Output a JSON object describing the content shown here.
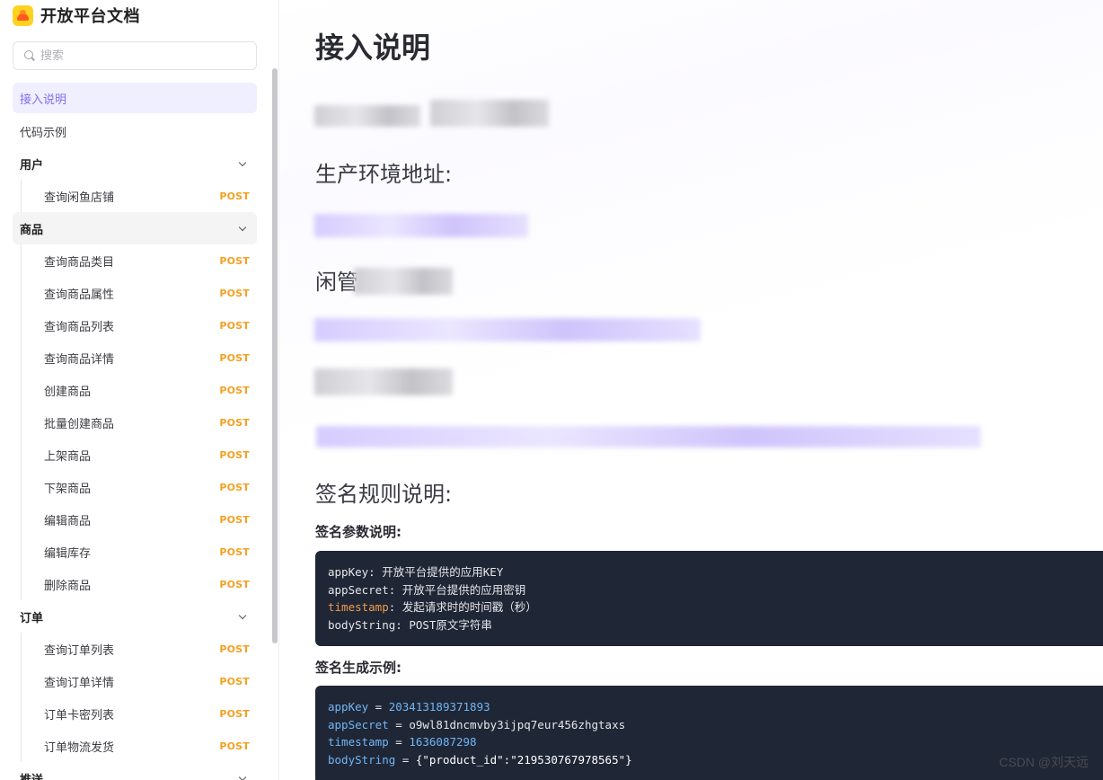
{
  "brand": {
    "title": "开放平台文档",
    "logo_icon": "fish-logo-icon"
  },
  "search": {
    "placeholder": "搜索"
  },
  "sidebar": {
    "intro": "接入说明",
    "code_example": "代码示例",
    "groups": [
      {
        "label": "用户",
        "items": [
          {
            "label": "查询闲鱼店铺",
            "method": "POST"
          }
        ]
      },
      {
        "label": "商品",
        "items": [
          {
            "label": "查询商品类目",
            "method": "POST"
          },
          {
            "label": "查询商品属性",
            "method": "POST"
          },
          {
            "label": "查询商品列表",
            "method": "POST"
          },
          {
            "label": "查询商品详情",
            "method": "POST"
          },
          {
            "label": "创建商品",
            "method": "POST"
          },
          {
            "label": "批量创建商品",
            "method": "POST"
          },
          {
            "label": "上架商品",
            "method": "POST"
          },
          {
            "label": "下架商品",
            "method": "POST"
          },
          {
            "label": "编辑商品",
            "method": "POST"
          },
          {
            "label": "编辑库存",
            "method": "POST"
          },
          {
            "label": "删除商品",
            "method": "POST"
          }
        ]
      },
      {
        "label": "订单",
        "items": [
          {
            "label": "查询订单列表",
            "method": "POST"
          },
          {
            "label": "查询订单详情",
            "method": "POST"
          },
          {
            "label": "订单卡密列表",
            "method": "POST"
          },
          {
            "label": "订单物流发货",
            "method": "POST"
          }
        ]
      },
      {
        "label": "推送",
        "items": []
      }
    ]
  },
  "main": {
    "title": "接入说明",
    "prod_env_heading": "生产环境地址:",
    "xianyu_heading": "闲管",
    "sign_heading": "签名规则说明:",
    "sign_params_heading": "签名参数说明:",
    "sign_example_heading": "签名生成示例:",
    "params_code": [
      {
        "key": "appKey",
        "desc": ": 开放平台提供的应用KEY"
      },
      {
        "key": "appSecret",
        "desc": ": 开放平台提供的应用密钥"
      },
      {
        "key": "timestamp",
        "desc": ": 发起请求时的时间戳（秒）"
      },
      {
        "key": "bodyString",
        "desc": ": POST原文字符串"
      }
    ],
    "example_code": [
      {
        "key": "appKey",
        "op": " = ",
        "value": "203413189371893"
      },
      {
        "key": "appSecret",
        "op": " = ",
        "value": "o9wl81dncmvby3ijpq7eur456zhgtaxs"
      },
      {
        "key": "timestamp",
        "op": " = ",
        "value": "1636087298"
      },
      {
        "key": "bodyString",
        "op": " = ",
        "value": "{\"product_id\":\"219530767978565\"}"
      }
    ]
  },
  "watermark": "CSDN @刘天远"
}
